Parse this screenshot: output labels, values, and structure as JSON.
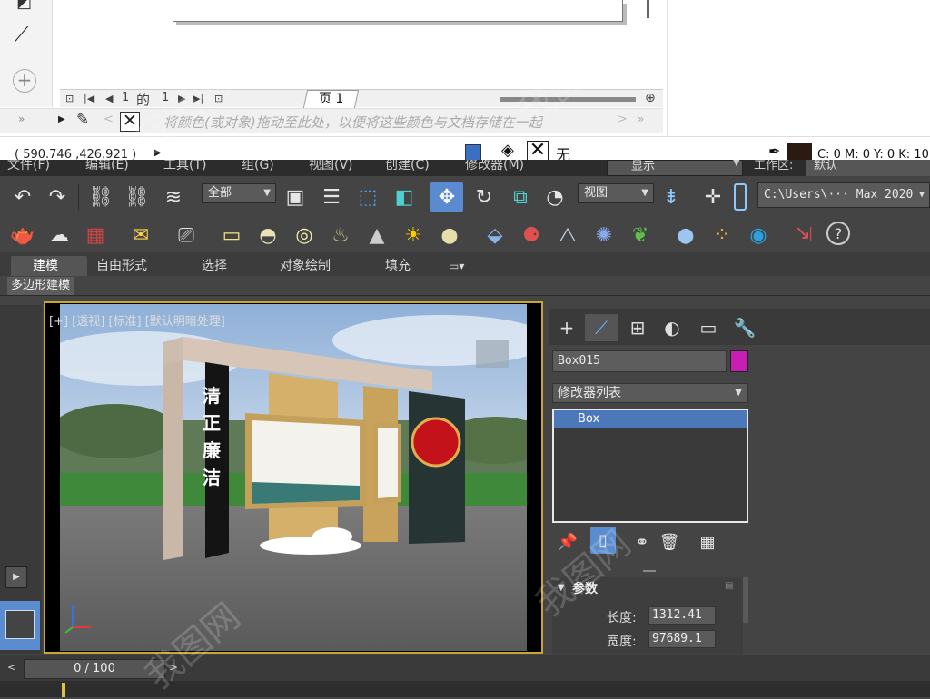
{
  "corel": {
    "page_nav": {
      "current": "1",
      "of_label": "的",
      "total": "1"
    },
    "page_tab": "页 1",
    "palette_hint": "将颜色(或对象)拖动至此处，以便将这些颜色与文档存储在一起",
    "coords": "( 590.746 ,426.921 )",
    "fill_none": "无",
    "cmyk": "C: 0 M: 0 Y: 0 K: 10"
  },
  "menubar": [
    "文件(F)",
    "编辑(E)",
    "工具(T)",
    "组(G)",
    "视图(V)",
    "创建(C)",
    "修改器(M)"
  ],
  "menubar_right": {
    "display": "显示",
    "workspace_label": "工作区:",
    "workspace_value": "默认"
  },
  "toolbar": {
    "selection_filter": "全部",
    "ref_coord": "视图",
    "project_path": "C:\\Users\\··· Max 2020"
  },
  "ribbon": {
    "tabs": [
      "建模",
      "自由形式",
      "选择",
      "对象绘制",
      "填充"
    ],
    "active_tab": "建模",
    "sub_label": "多边形建模"
  },
  "viewport": {
    "label": "[+] [透视] [标准] [默认明暗处理]",
    "sign_text": [
      "清",
      "正",
      "廉",
      "洁"
    ]
  },
  "command_panel": {
    "object_name": "Box015",
    "object_color": "#c81eb4",
    "modifier_list": "修改器列表",
    "stack_items": [
      "Box"
    ],
    "rollout_title": "参数",
    "params": [
      {
        "label": "长度:",
        "value": "1312.41"
      },
      {
        "label": "宽度:",
        "value": "97689.1"
      }
    ]
  },
  "timeline": {
    "slider": "0 / 100"
  },
  "watermark": "我图网"
}
